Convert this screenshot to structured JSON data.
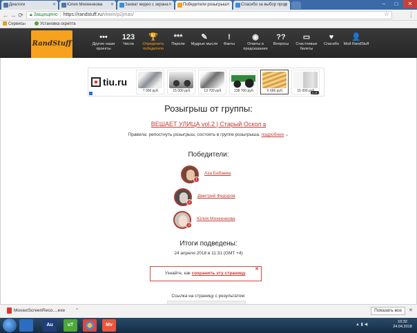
{
  "browser": {
    "tabs": [
      {
        "label": "Диалоги",
        "icon": "vk-icon",
        "color": "#4a76a8",
        "active": false
      },
      {
        "label": "Юлия Михеенкова",
        "icon": "vk-icon",
        "color": "#4a76a8",
        "active": false
      },
      {
        "label": "Захват видео с экрана",
        "icon": "movavi-icon",
        "color": "#3b8be0",
        "active": false
      },
      {
        "label": "Победители розыгрыш",
        "icon": "randstuff-icon",
        "color": "#f6a21e",
        "active": true
      },
      {
        "label": "Спасибо за выбор прод",
        "icon": "movavi-icon",
        "color": "#3b8be0",
        "active": false
      }
    ],
    "address": {
      "secure_label": "Защищено",
      "url_host": "https://randstuff.ru",
      "url_path": "/vkwin/p2jmas/"
    },
    "bookmarks": [
      {
        "label": "Сервисы"
      },
      {
        "label": "Установка скрипта"
      }
    ]
  },
  "site": {
    "logo": "RandStuff",
    "nav": [
      {
        "icon": "•••",
        "label": "Другие наши проекты"
      },
      {
        "icon": "123",
        "label": "Числа"
      },
      {
        "icon": "🏆",
        "label": "Определить победителя",
        "active": true
      },
      {
        "icon": "***",
        "label": "Пароли"
      },
      {
        "icon": "✎",
        "label": "Мудрые мысли"
      },
      {
        "icon": "!",
        "label": "Факты"
      },
      {
        "icon": "◉",
        "label": "Ответы и предсказания"
      },
      {
        "icon": "??",
        "label": "Вопросы"
      },
      {
        "icon": "▭",
        "label": "Счастливые билеты"
      },
      {
        "icon": "♥",
        "label": "Спасибо"
      },
      {
        "icon": "👤",
        "label": "Мой RandStuff"
      }
    ]
  },
  "ads": {
    "brand": "tiu.ru",
    "items": [
      {
        "price": "7 000 руб.",
        "color": "#8a8f95"
      },
      {
        "price": "15 000 руб.",
        "color": "#5b5b5b"
      },
      {
        "price": "13 700 руб.",
        "color": "#707070"
      },
      {
        "price": "138 700 руб.",
        "color": "#2f8a3a"
      },
      {
        "price": "5 666 руб.",
        "color": "#d9a04a"
      },
      {
        "price": "15 000 руб.",
        "color": "#c9c9c9"
      }
    ]
  },
  "page": {
    "title": "Розыгрыш от группы:",
    "group_link": "ВЕШАЕТ УЛИЦА vol.2 | Старый Оскол",
    "rules_text": "Правила: репостнуть розыгрыш, состоять в группе розыгрыша.",
    "rules_more": "подробнее",
    "winners_heading": "Победители:",
    "winners": [
      {
        "name": "Аза Бабаева",
        "rank": "1"
      },
      {
        "name": "Дмитрий Федоров",
        "rank": "2"
      },
      {
        "name": "Юлия Михеенкова",
        "rank": "3"
      }
    ],
    "results_heading": "Итоги подведены:",
    "results_date": "24 апреля 2018 в 11:31 (GMT +4)",
    "notice_prefix": "Узнайте, как",
    "notice_link": "сохранить эту страницу",
    "link_label": "Ссылка на страницу с результатом:"
  },
  "download": {
    "file": "MovaviScreenReco....exe",
    "show_all": "Показать все"
  },
  "taskbar": {
    "apps": [
      "Au",
      "uT",
      "Ch",
      "Mv"
    ],
    "time": "10:32",
    "date": "24.04.2018"
  }
}
